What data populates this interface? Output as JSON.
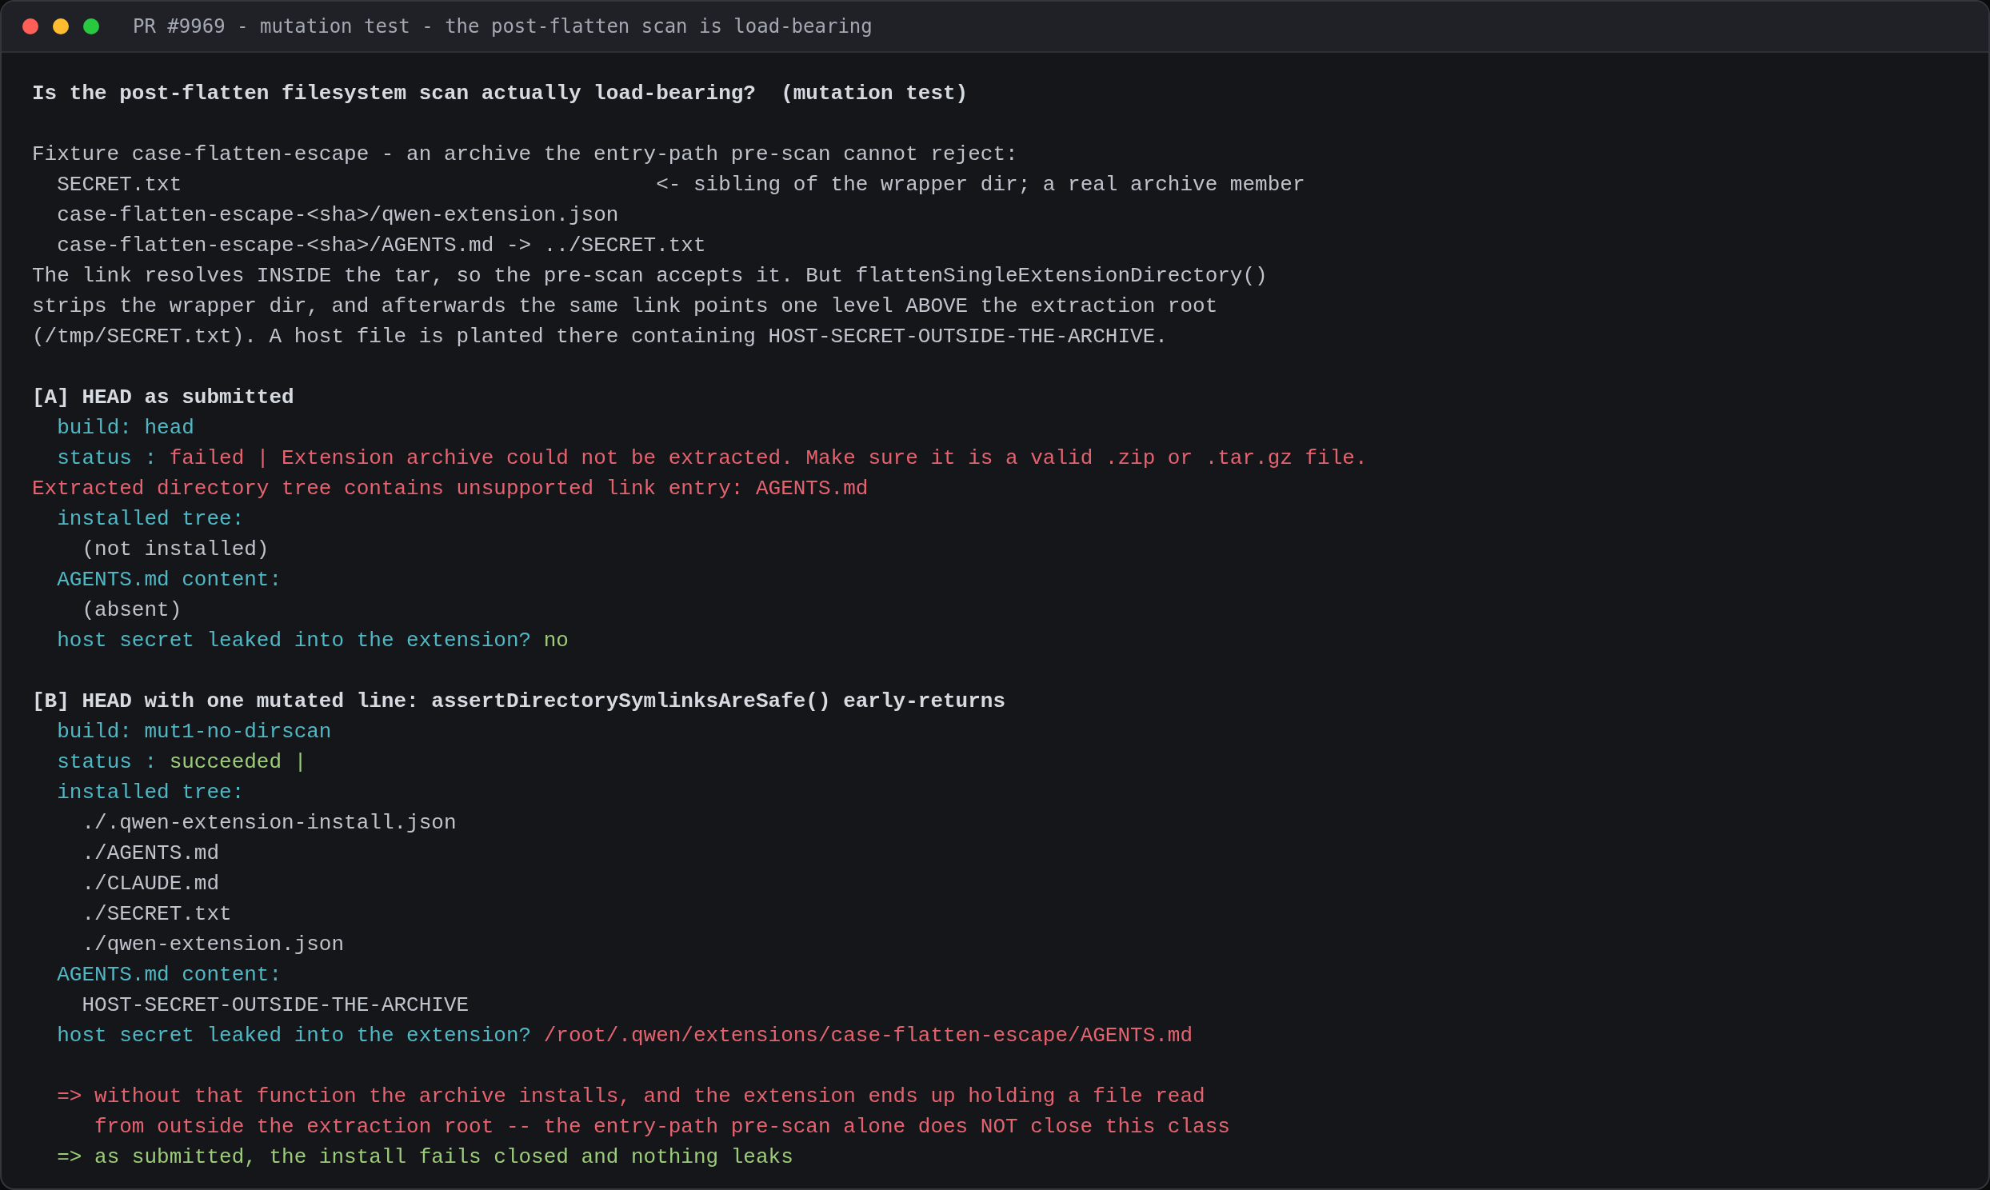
{
  "window": {
    "title": "PR #9969 - mutation test - the post-flatten scan is load-bearing"
  },
  "blocks": [
    {
      "lines": [
        [
          {
            "kind": "heading",
            "text": "Is the post-flatten filesystem scan actually load-bearing?  (mutation test)"
          }
        ]
      ]
    },
    {
      "lines": [
        [
          {
            "kind": "text",
            "text": "Fixture case-flatten-escape - an archive the entry-path pre-scan cannot reject:"
          }
        ],
        [
          {
            "kind": "text",
            "text": "  SECRET.txt"
          },
          {
            "kind": "text",
            "text": "                                      <- sibling of the wrapper dir; a real archive member"
          }
        ],
        [
          {
            "kind": "text",
            "text": "  case-flatten-escape-<sha>/qwen-extension.json"
          }
        ],
        [
          {
            "kind": "text",
            "text": "  case-flatten-escape-<sha>/AGENTS.md -> ../SECRET.txt"
          }
        ],
        [
          {
            "kind": "text",
            "text": "The link resolves INSIDE the tar, so the pre-scan accepts it. But flattenSingleExtensionDirectory()"
          }
        ],
        [
          {
            "kind": "text",
            "text": "strips the wrapper dir, and afterwards the same link points one level ABOVE the extraction root"
          }
        ],
        [
          {
            "kind": "text",
            "text": "(/tmp/SECRET.txt). A host file is planted there containing HOST-SECRET-OUTSIDE-THE-ARCHIVE."
          }
        ]
      ]
    },
    {
      "lines": [
        [
          {
            "kind": "heading",
            "text": "[A] HEAD as submitted"
          }
        ],
        [
          {
            "kind": "label",
            "text": "  build: head"
          }
        ],
        [
          {
            "kind": "label",
            "text": "  status : "
          },
          {
            "kind": "error",
            "text": "failed | Extension archive could not be extracted. Make sure it is a valid .zip or .tar.gz file."
          }
        ],
        [
          {
            "kind": "error",
            "text": "Extracted directory tree contains unsupported link entry: AGENTS.md"
          }
        ],
        [
          {
            "kind": "label",
            "text": "  installed tree:"
          }
        ],
        [
          {
            "kind": "text",
            "text": "    (not installed)"
          }
        ],
        [
          {
            "kind": "label",
            "text": "  AGENTS.md content:"
          }
        ],
        [
          {
            "kind": "text",
            "text": "    (absent)"
          }
        ],
        [
          {
            "kind": "label",
            "text": "  host secret leaked into the extension? "
          },
          {
            "kind": "ok",
            "text": "no"
          }
        ]
      ]
    },
    {
      "lines": [
        [
          {
            "kind": "heading",
            "text": "[B] HEAD with one mutated line: assertDirectorySymlinksAreSafe() early-returns"
          }
        ],
        [
          {
            "kind": "label",
            "text": "  build: mut1-no-dirscan"
          }
        ],
        [
          {
            "kind": "label",
            "text": "  status : "
          },
          {
            "kind": "ok",
            "text": "succeeded |"
          }
        ],
        [
          {
            "kind": "label",
            "text": "  installed tree:"
          }
        ],
        [
          {
            "kind": "text",
            "text": "    ./.qwen-extension-install.json"
          }
        ],
        [
          {
            "kind": "text",
            "text": "    ./AGENTS.md"
          }
        ],
        [
          {
            "kind": "text",
            "text": "    ./CLAUDE.md"
          }
        ],
        [
          {
            "kind": "text",
            "text": "    ./SECRET.txt"
          }
        ],
        [
          {
            "kind": "text",
            "text": "    ./qwen-extension.json"
          }
        ],
        [
          {
            "kind": "label",
            "text": "  AGENTS.md content:"
          }
        ],
        [
          {
            "kind": "text",
            "text": "    HOST-SECRET-OUTSIDE-THE-ARCHIVE"
          }
        ],
        [
          {
            "kind": "label",
            "text": "  host secret leaked into the extension? "
          },
          {
            "kind": "error",
            "text": "/root/.qwen/extensions/case-flatten-escape/AGENTS.md"
          }
        ]
      ]
    },
    {
      "lines": [
        [
          {
            "kind": "error",
            "text": "  => without that function the archive installs, and the extension ends up holding a file read"
          }
        ],
        [
          {
            "kind": "error",
            "text": "     from outside the extraction root -- the entry-path pre-scan alone does NOT close this class"
          }
        ],
        [
          {
            "kind": "ok",
            "text": "  => as submitted, the install fails closed and nothing leaks"
          }
        ]
      ]
    }
  ]
}
